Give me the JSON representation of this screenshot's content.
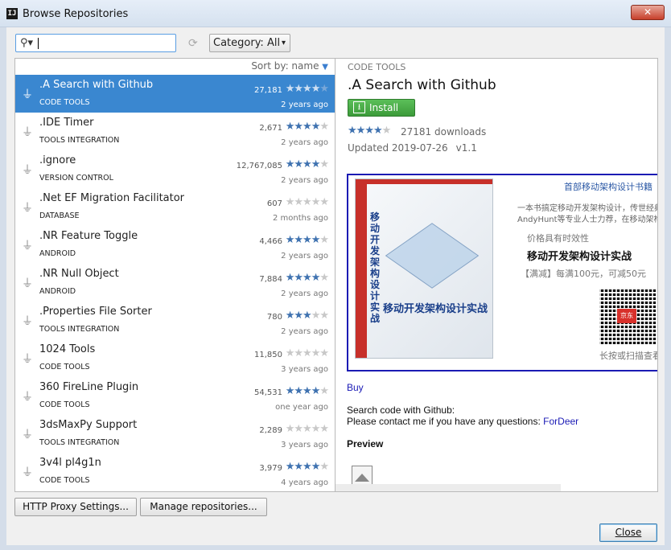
{
  "window": {
    "title": "Browse Repositories",
    "app_icon_text": "IJ",
    "close_glyph": "✕"
  },
  "toolbar": {
    "search_value": "",
    "search_icon_glyph": "⚲▾",
    "refresh_glyph": "⟳",
    "category_label": "Category: All",
    "category_arrow": "▾"
  },
  "list": {
    "sort_label": "Sort by: name",
    "sort_arrow": "▼",
    "plugin_glyph": "⏚",
    "items": [
      {
        "name": ".A Search with Github",
        "category": "CODE TOOLS",
        "downloads": "27,181",
        "rating": 4,
        "age": "2 years ago"
      },
      {
        "name": ".IDE Timer",
        "category": "TOOLS INTEGRATION",
        "downloads": "2,671",
        "rating": 4.5,
        "age": "2 years ago"
      },
      {
        "name": ".ignore",
        "category": "VERSION CONTROL",
        "downloads": "12,767,085",
        "rating": 4,
        "age": "2 years ago"
      },
      {
        "name": ".Net EF Migration Facilitator",
        "category": "DATABASE",
        "downloads": "607",
        "rating": 0,
        "age": "2 months ago"
      },
      {
        "name": ".NR Feature Toggle",
        "category": "ANDROID",
        "downloads": "4,466",
        "rating": 4.5,
        "age": "2 years ago"
      },
      {
        "name": ".NR Null Object",
        "category": "ANDROID",
        "downloads": "7,884",
        "rating": 4.5,
        "age": "2 years ago"
      },
      {
        "name": ".Properties File Sorter",
        "category": "TOOLS INTEGRATION",
        "downloads": "780",
        "rating": 3,
        "age": "2 years ago"
      },
      {
        "name": "1024 Tools",
        "category": "CODE TOOLS",
        "downloads": "11,850",
        "rating": 0,
        "age": "3 years ago"
      },
      {
        "name": "360 FireLine Plugin",
        "category": "CODE TOOLS",
        "downloads": "54,531",
        "rating": 4,
        "age": "one year ago"
      },
      {
        "name": "3dsMaxPy Support",
        "category": "TOOLS INTEGRATION",
        "downloads": "2,289",
        "rating": 0,
        "age": "3 years ago"
      },
      {
        "name": "3v4l pl4g1n",
        "category": "CODE TOOLS",
        "downloads": "3,979",
        "rating": 4.5,
        "age": "4 years ago"
      }
    ]
  },
  "detail": {
    "category": "CODE TOOLS",
    "name": ".A Search with Github",
    "install_label": "Install",
    "install_icon_glyph": "⭳",
    "rating": 4,
    "downloads": "27181 downloads",
    "updated": "Updated 2019-07-26",
    "version": "v1.1",
    "banner": {
      "book_title_vertical": "移动开发架构设计实战",
      "book_title": "移动开发架构设计实战",
      "headline": "首部移动架构设计书籍",
      "line1": "一本书搞定移动开发架构设计，传世经典",
      "line2": "AndyHunt等专业人士力荐，在移动架构开发",
      "validity": "价格具有时效性",
      "title": "移动开发架构设计实战",
      "promo": "【满减】每满100元，可减50元",
      "qr_badge": "京东",
      "scan": "长按或扫描查看"
    },
    "buy_link": "Buy",
    "desc_line1": "Search code with Github:",
    "desc_line2": "Please contact me if you have any questions: ",
    "contact_link": "ForDeer",
    "preview_heading": "Preview"
  },
  "buttons": {
    "proxy": "HTTP Proxy Settings...",
    "manage": "Manage repositories...",
    "close": "Close"
  },
  "colors": {
    "selection": "#3a87d0",
    "install_green": "#3c9b3a",
    "star_on": "#3f72b0",
    "link": "#1a1ab5"
  }
}
